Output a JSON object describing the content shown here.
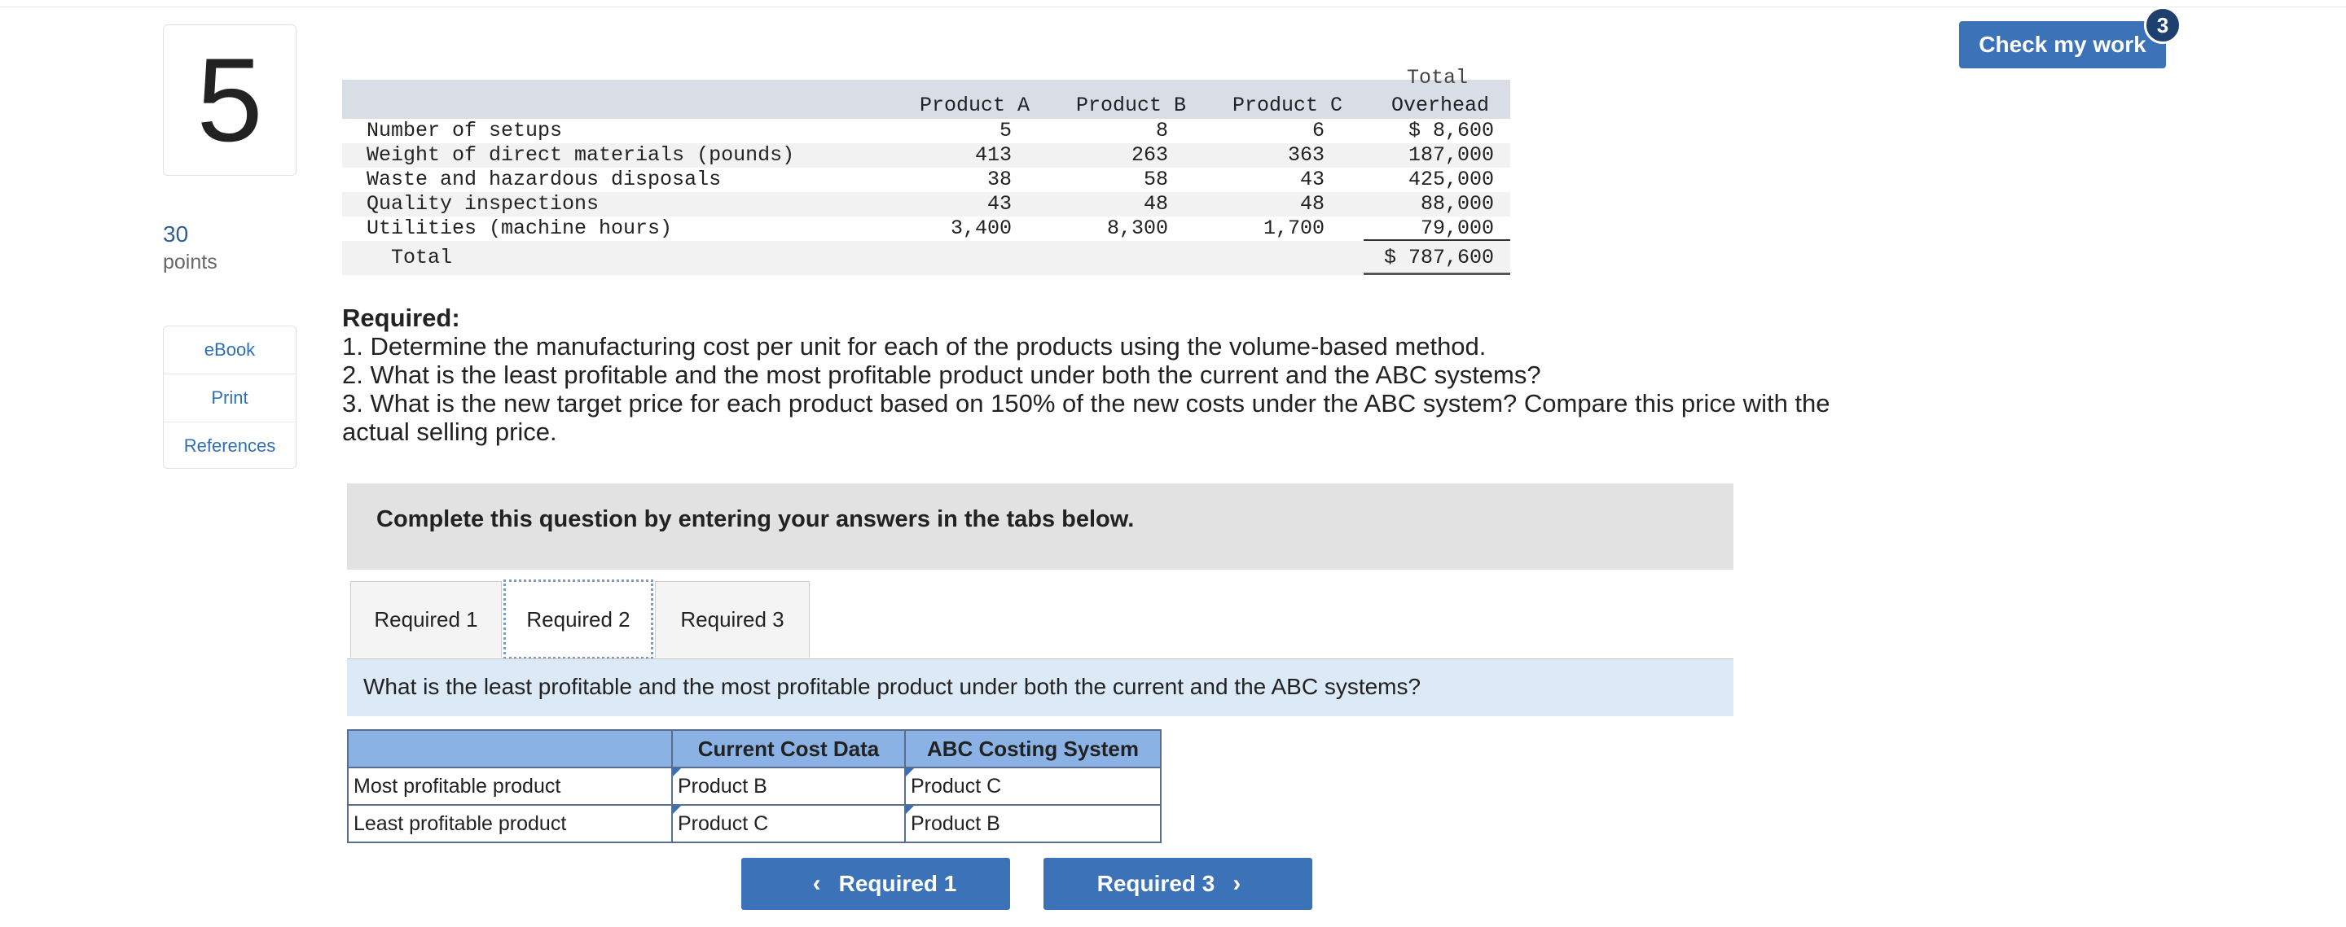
{
  "question": {
    "number": "5",
    "points_value": "30",
    "points_label": "points"
  },
  "side_links": [
    "eBook",
    "Print",
    "References"
  ],
  "check_button": {
    "label": "Check my work",
    "badge": "3"
  },
  "overhead_table": {
    "header": {
      "total_top": "Total",
      "col_a": "Product A",
      "col_b": "Product B",
      "col_c": "Product C",
      "col_total": "Overhead"
    },
    "rows": [
      {
        "label": "Number of setups",
        "a": "5",
        "b": "8",
        "c": "6",
        "total": "$ 8,600"
      },
      {
        "label": "Weight of direct materials (pounds)",
        "a": "413",
        "b": "263",
        "c": "363",
        "total": "187,000"
      },
      {
        "label": "Waste and hazardous disposals",
        "a": "38",
        "b": "58",
        "c": "43",
        "total": "425,000"
      },
      {
        "label": "Quality inspections",
        "a": "43",
        "b": "48",
        "c": "48",
        "total": "88,000"
      },
      {
        "label": "Utilities (machine hours)",
        "a": "3,400",
        "b": "8,300",
        "c": "1,700",
        "total": "79,000"
      }
    ],
    "total_row": {
      "label": "Total",
      "total": "$ 787,600"
    }
  },
  "required": {
    "title": "Required:",
    "items": [
      "1. Determine the manufacturing cost per unit for each of the products using the volume-based method.",
      "2. What is the least profitable and the most profitable product under both the current and the ABC systems?",
      "3. What is the new target price for each product based on 150% of the new costs under the ABC system? Compare this price with the actual selling price."
    ]
  },
  "instruction": "Complete this question by entering your answers in the tabs below.",
  "tabs": [
    {
      "label": "Required 1",
      "active": false
    },
    {
      "label": "Required 2",
      "active": true
    },
    {
      "label": "Required 3",
      "active": false
    }
  ],
  "tab_question": "What is the least profitable and the most profitable product under both the current and the ABC systems?",
  "answer_table": {
    "headers": [
      "Current Cost Data",
      "ABC Costing System"
    ],
    "rows": [
      {
        "label": "Most profitable product",
        "current": "Product B",
        "abc": "Product C"
      },
      {
        "label": "Least profitable product",
        "current": "Product C",
        "abc": "Product B"
      }
    ]
  },
  "nav": {
    "prev_label": "Required 1",
    "next_label": "Required 3"
  },
  "colors": {
    "accent": "#3b72b8",
    "header_blue": "#8bb2e4",
    "question_bar": "#dce9f7"
  }
}
